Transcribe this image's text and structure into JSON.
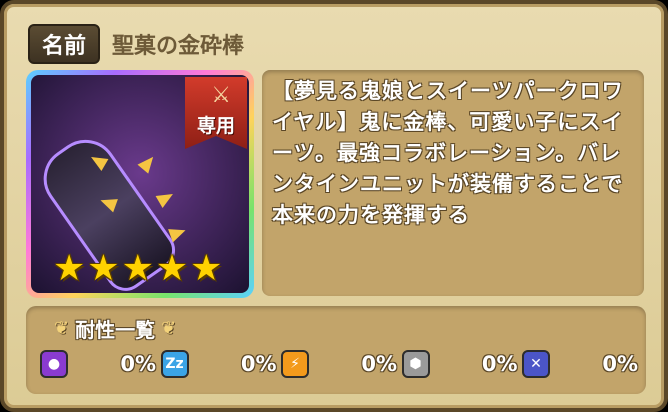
{
  "header": {
    "name_tag": "名前",
    "item_name": "聖菓の金砕棒"
  },
  "icon": {
    "exclusive_label": "専用",
    "exclusive_icon": "crossed-swords-icon",
    "stars": [
      "★",
      "★",
      "★",
      "★",
      "★"
    ]
  },
  "description": [
    "【夢見る鬼娘とスイーツパークロワ",
    "イヤル】鬼に金棒、可愛い子にスイ",
    "ーツ。最強コラボレーション。バレ",
    "ンタインユニットが装備することで",
    "本来の力を発揮する"
  ],
  "resistance": {
    "title": "耐性一覧",
    "items": [
      {
        "icon": "poison-icon",
        "glyph": "●",
        "color": "#8a3bd0",
        "value": "0%"
      },
      {
        "icon": "sleep-icon",
        "glyph": "Zz",
        "color": "#3ba4e6",
        "value": "0%"
      },
      {
        "icon": "paralysis-icon",
        "glyph": "⚡",
        "color": "#f39a1c",
        "value": "0%"
      },
      {
        "icon": "petrify-icon",
        "glyph": "⬢",
        "color": "#9a9a9a",
        "value": "0%"
      },
      {
        "icon": "seal-icon",
        "glyph": "✕",
        "color": "#4b55c8",
        "value": "0%"
      }
    ]
  }
}
